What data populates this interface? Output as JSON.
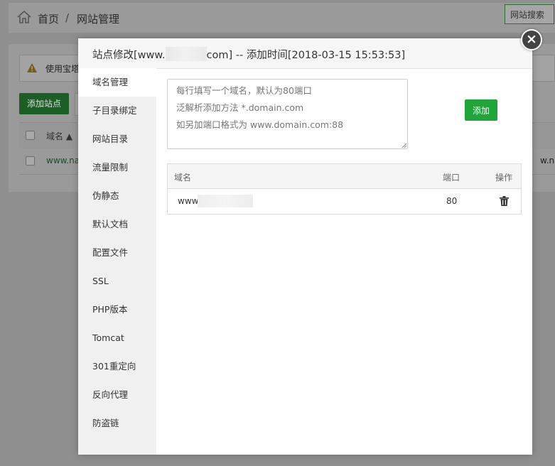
{
  "breadcrumb": {
    "home": "首页",
    "separator": "/",
    "current": "网站管理"
  },
  "top_search": {
    "label": "网站搜索"
  },
  "warning": {
    "text": "使用宝塔"
  },
  "site_list": {
    "add_button": "添加站点",
    "header_domain": "域名 ▲",
    "row_domain": "www.na",
    "row_right": "w.natu"
  },
  "modal": {
    "title_prefix": "站点修改[www.",
    "title_suffix": "com] -- 添加时间[2018-03-15 15:53:53]",
    "close_label": "×",
    "menu": [
      {
        "label": "域名管理",
        "active": true
      },
      {
        "label": "子目录绑定"
      },
      {
        "label": "网站目录"
      },
      {
        "label": "流量限制"
      },
      {
        "label": "伪静态"
      },
      {
        "label": "默认文档"
      },
      {
        "label": "配置文件"
      },
      {
        "label": "SSL"
      },
      {
        "label": "PHP版本"
      },
      {
        "label": "Tomcat"
      },
      {
        "label": "301重定向"
      },
      {
        "label": "反向代理"
      },
      {
        "label": "防盗链"
      }
    ],
    "domain_input": {
      "placeholder": "每行填写一个域名，默认为80端口\n泛解析添加方法 *.domain.com\n如另加端口格式为 www.domain.com:88",
      "value": ""
    },
    "add_button": "添加",
    "table": {
      "headers": {
        "domain": "域名",
        "port": "端口",
        "action": "操作"
      },
      "rows": [
        {
          "domain": "www",
          "port": "80"
        }
      ]
    }
  },
  "colors": {
    "primary_green": "#20a53a",
    "overlay": "#8f8f8f",
    "sidebar": "#f0f0f0"
  },
  "icons": {
    "home": "home-icon",
    "warning": "warning-icon",
    "close": "close-icon",
    "delete": "trash-icon"
  }
}
